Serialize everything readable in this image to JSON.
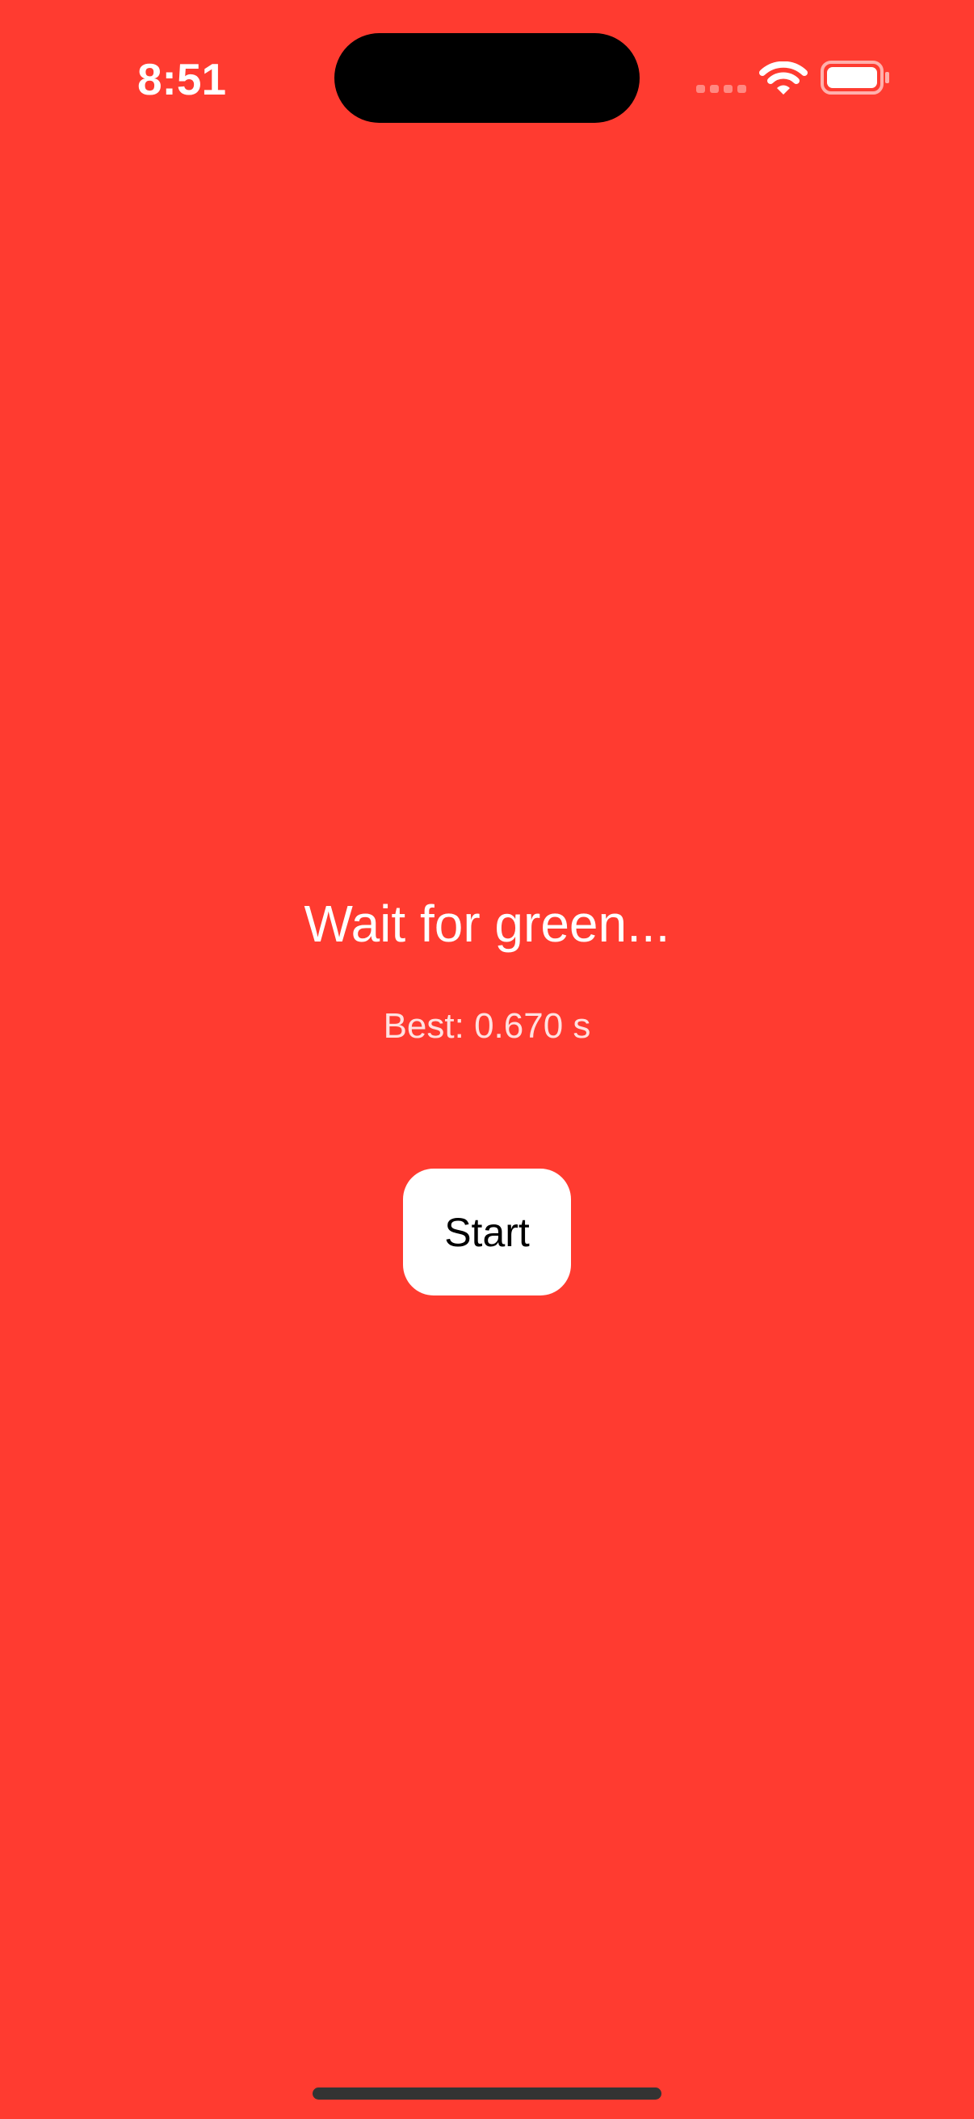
{
  "status_bar": {
    "time": "8:51"
  },
  "main": {
    "title": "Wait for green...",
    "best": "Best: 0.670 s",
    "start_label": "Start"
  },
  "colors": {
    "background": "#FF3B30",
    "button": "#FFFFFF"
  },
  "icons": [
    "signal-icon",
    "wifi-icon",
    "battery-icon"
  ]
}
